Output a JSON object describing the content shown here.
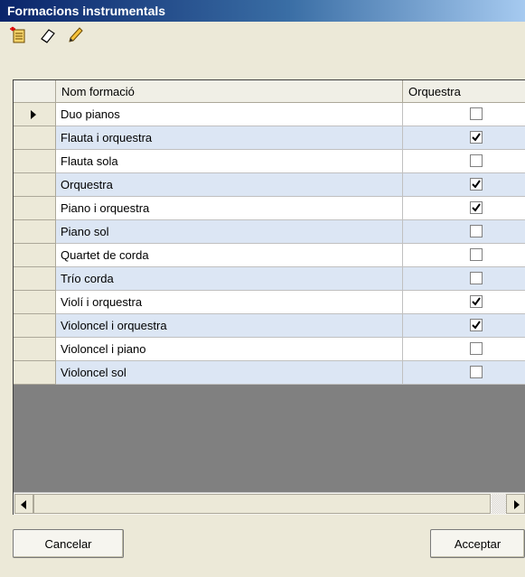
{
  "window": {
    "title": "Formacions instrumentals"
  },
  "toolbar": {
    "icons": [
      "new-record-icon",
      "eraser-icon",
      "pencil-icon"
    ]
  },
  "grid": {
    "columns": [
      "Nom formació",
      "Orquestra"
    ],
    "rows": [
      {
        "name": "Duo pianos",
        "orquestra": false,
        "current": true
      },
      {
        "name": "Flauta i orquestra",
        "orquestra": true
      },
      {
        "name": "Flauta sola",
        "orquestra": false
      },
      {
        "name": "Orquestra",
        "orquestra": true
      },
      {
        "name": "Piano i orquestra",
        "orquestra": true
      },
      {
        "name": "Piano sol",
        "orquestra": false
      },
      {
        "name": "Quartet de corda",
        "orquestra": false
      },
      {
        "name": "Trío corda",
        "orquestra": false
      },
      {
        "name": "Violí i orquestra",
        "orquestra": true
      },
      {
        "name": "Violoncel i orquestra",
        "orquestra": true
      },
      {
        "name": "Violoncel i piano",
        "orquestra": false
      },
      {
        "name": "Violoncel sol",
        "orquestra": false
      }
    ]
  },
  "buttons": {
    "cancel": "Cancelar",
    "accept": "Acceptar"
  },
  "colors": {
    "title_start": "#0a246a",
    "row_alt": "#dce6f4",
    "grid_empty": "#808080"
  }
}
